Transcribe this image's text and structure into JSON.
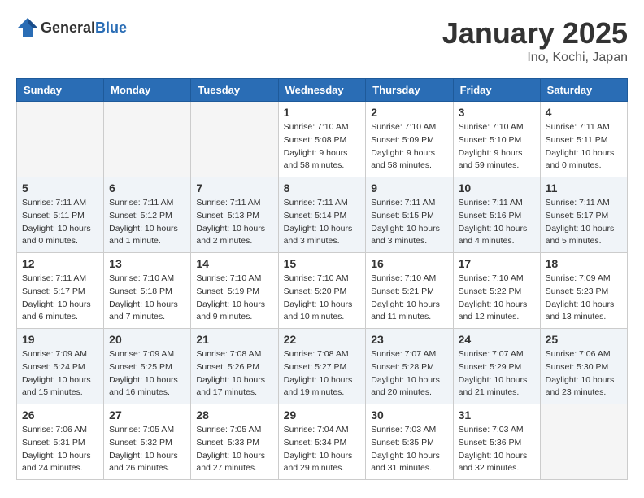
{
  "header": {
    "logo_general": "General",
    "logo_blue": "Blue",
    "month_year": "January 2025",
    "location": "Ino, Kochi, Japan"
  },
  "weekdays": [
    "Sunday",
    "Monday",
    "Tuesday",
    "Wednesday",
    "Thursday",
    "Friday",
    "Saturday"
  ],
  "weeks": [
    {
      "shaded": false,
      "days": [
        {
          "num": "",
          "info": ""
        },
        {
          "num": "",
          "info": ""
        },
        {
          "num": "",
          "info": ""
        },
        {
          "num": "1",
          "info": "Sunrise: 7:10 AM\nSunset: 5:08 PM\nDaylight: 9 hours\nand 58 minutes."
        },
        {
          "num": "2",
          "info": "Sunrise: 7:10 AM\nSunset: 5:09 PM\nDaylight: 9 hours\nand 58 minutes."
        },
        {
          "num": "3",
          "info": "Sunrise: 7:10 AM\nSunset: 5:10 PM\nDaylight: 9 hours\nand 59 minutes."
        },
        {
          "num": "4",
          "info": "Sunrise: 7:11 AM\nSunset: 5:11 PM\nDaylight: 10 hours\nand 0 minutes."
        }
      ]
    },
    {
      "shaded": true,
      "days": [
        {
          "num": "5",
          "info": "Sunrise: 7:11 AM\nSunset: 5:11 PM\nDaylight: 10 hours\nand 0 minutes."
        },
        {
          "num": "6",
          "info": "Sunrise: 7:11 AM\nSunset: 5:12 PM\nDaylight: 10 hours\nand 1 minute."
        },
        {
          "num": "7",
          "info": "Sunrise: 7:11 AM\nSunset: 5:13 PM\nDaylight: 10 hours\nand 2 minutes."
        },
        {
          "num": "8",
          "info": "Sunrise: 7:11 AM\nSunset: 5:14 PM\nDaylight: 10 hours\nand 3 minutes."
        },
        {
          "num": "9",
          "info": "Sunrise: 7:11 AM\nSunset: 5:15 PM\nDaylight: 10 hours\nand 3 minutes."
        },
        {
          "num": "10",
          "info": "Sunrise: 7:11 AM\nSunset: 5:16 PM\nDaylight: 10 hours\nand 4 minutes."
        },
        {
          "num": "11",
          "info": "Sunrise: 7:11 AM\nSunset: 5:17 PM\nDaylight: 10 hours\nand 5 minutes."
        }
      ]
    },
    {
      "shaded": false,
      "days": [
        {
          "num": "12",
          "info": "Sunrise: 7:11 AM\nSunset: 5:17 PM\nDaylight: 10 hours\nand 6 minutes."
        },
        {
          "num": "13",
          "info": "Sunrise: 7:10 AM\nSunset: 5:18 PM\nDaylight: 10 hours\nand 7 minutes."
        },
        {
          "num": "14",
          "info": "Sunrise: 7:10 AM\nSunset: 5:19 PM\nDaylight: 10 hours\nand 9 minutes."
        },
        {
          "num": "15",
          "info": "Sunrise: 7:10 AM\nSunset: 5:20 PM\nDaylight: 10 hours\nand 10 minutes."
        },
        {
          "num": "16",
          "info": "Sunrise: 7:10 AM\nSunset: 5:21 PM\nDaylight: 10 hours\nand 11 minutes."
        },
        {
          "num": "17",
          "info": "Sunrise: 7:10 AM\nSunset: 5:22 PM\nDaylight: 10 hours\nand 12 minutes."
        },
        {
          "num": "18",
          "info": "Sunrise: 7:09 AM\nSunset: 5:23 PM\nDaylight: 10 hours\nand 13 minutes."
        }
      ]
    },
    {
      "shaded": true,
      "days": [
        {
          "num": "19",
          "info": "Sunrise: 7:09 AM\nSunset: 5:24 PM\nDaylight: 10 hours\nand 15 minutes."
        },
        {
          "num": "20",
          "info": "Sunrise: 7:09 AM\nSunset: 5:25 PM\nDaylight: 10 hours\nand 16 minutes."
        },
        {
          "num": "21",
          "info": "Sunrise: 7:08 AM\nSunset: 5:26 PM\nDaylight: 10 hours\nand 17 minutes."
        },
        {
          "num": "22",
          "info": "Sunrise: 7:08 AM\nSunset: 5:27 PM\nDaylight: 10 hours\nand 19 minutes."
        },
        {
          "num": "23",
          "info": "Sunrise: 7:07 AM\nSunset: 5:28 PM\nDaylight: 10 hours\nand 20 minutes."
        },
        {
          "num": "24",
          "info": "Sunrise: 7:07 AM\nSunset: 5:29 PM\nDaylight: 10 hours\nand 21 minutes."
        },
        {
          "num": "25",
          "info": "Sunrise: 7:06 AM\nSunset: 5:30 PM\nDaylight: 10 hours\nand 23 minutes."
        }
      ]
    },
    {
      "shaded": false,
      "days": [
        {
          "num": "26",
          "info": "Sunrise: 7:06 AM\nSunset: 5:31 PM\nDaylight: 10 hours\nand 24 minutes."
        },
        {
          "num": "27",
          "info": "Sunrise: 7:05 AM\nSunset: 5:32 PM\nDaylight: 10 hours\nand 26 minutes."
        },
        {
          "num": "28",
          "info": "Sunrise: 7:05 AM\nSunset: 5:33 PM\nDaylight: 10 hours\nand 27 minutes."
        },
        {
          "num": "29",
          "info": "Sunrise: 7:04 AM\nSunset: 5:34 PM\nDaylight: 10 hours\nand 29 minutes."
        },
        {
          "num": "30",
          "info": "Sunrise: 7:03 AM\nSunset: 5:35 PM\nDaylight: 10 hours\nand 31 minutes."
        },
        {
          "num": "31",
          "info": "Sunrise: 7:03 AM\nSunset: 5:36 PM\nDaylight: 10 hours\nand 32 minutes."
        },
        {
          "num": "",
          "info": ""
        }
      ]
    }
  ]
}
